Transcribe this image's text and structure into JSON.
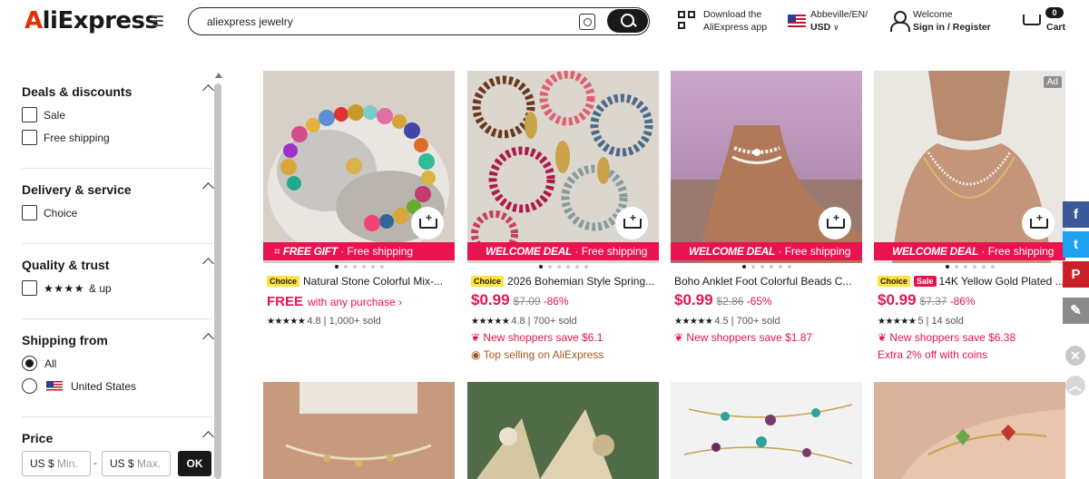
{
  "header": {
    "logo": "AliExpress",
    "search_value": "aliexpress jewelry",
    "app_line1": "Download the",
    "app_line2": "AliExpress app",
    "locale_line1": "Abbeville/EN/",
    "locale_line2": "USD",
    "welcome": "Welcome",
    "signin": "Sign in / Register",
    "cart_count": "0",
    "cart_label": "Cart"
  },
  "sidebar": {
    "deals": {
      "title": "Deals & discounts",
      "options": [
        "Sale",
        "Free shipping"
      ]
    },
    "delivery": {
      "title": "Delivery & service",
      "options": [
        "Choice"
      ]
    },
    "quality": {
      "title": "Quality & trust",
      "stars": "★★★★",
      "suffix": "& up"
    },
    "shipping": {
      "title": "Shipping from",
      "options": [
        "All",
        "United States"
      ],
      "selected": "All"
    },
    "price": {
      "title": "Price",
      "min_prefix": "US $",
      "min_placeholder": "Min.",
      "dash": "-",
      "max_prefix": "US $",
      "max_placeholder": "Max.",
      "ok": "OK"
    }
  },
  "products": [
    {
      "banner_strong": "FREE GIFT",
      "banner_rest": " · Free shipping",
      "choice": "Choice",
      "title": "Natural Stone Colorful Mix-...",
      "price_free": "FREE",
      "price_sub": "with any purchase ›",
      "stars": "★★★★★",
      "rating": "4.8",
      "sold": "1,000+ sold"
    },
    {
      "banner_strong": "WELCOME DEAL",
      "banner_rest": " · Free shipping",
      "choice": "Choice",
      "title": "2026 Bohemian Style Spring...",
      "price": "$0.99",
      "orig": "$7.09",
      "disc": "-86%",
      "stars": "★★★★★",
      "rating": "4.8",
      "sold": "700+ sold",
      "extra1": "New shoppers save $6.1",
      "extra2": "Top selling on AliExpress"
    },
    {
      "banner_strong": "WELCOME DEAL",
      "banner_rest": " · Free shipping",
      "title": "Boho Anklet Foot Colorful Beads C...",
      "price": "$0.99",
      "orig": "$2.86",
      "disc": "-65%",
      "stars": "★★★★★",
      "rating": "4.5",
      "sold": "700+ sold",
      "extra1": "New shoppers save $1.87"
    },
    {
      "ad": "Ad",
      "banner_strong": "WELCOME DEAL",
      "banner_rest": " · Free shipping",
      "choice": "Choice",
      "sale": "Sale",
      "title": "14K Yellow Gold Plated ...",
      "price": "$0.99",
      "orig": "$7.37",
      "disc": "-86%",
      "stars": "★★★★★",
      "rating": "5",
      "sold": "14 sold",
      "extra1": "New shoppers save $6.38",
      "extra2": "Extra 2% off with coins"
    }
  ],
  "social": {
    "facebook": "f",
    "twitter": "t",
    "pinterest": "P",
    "edit": "✎",
    "close": "✕",
    "top": "︿"
  }
}
